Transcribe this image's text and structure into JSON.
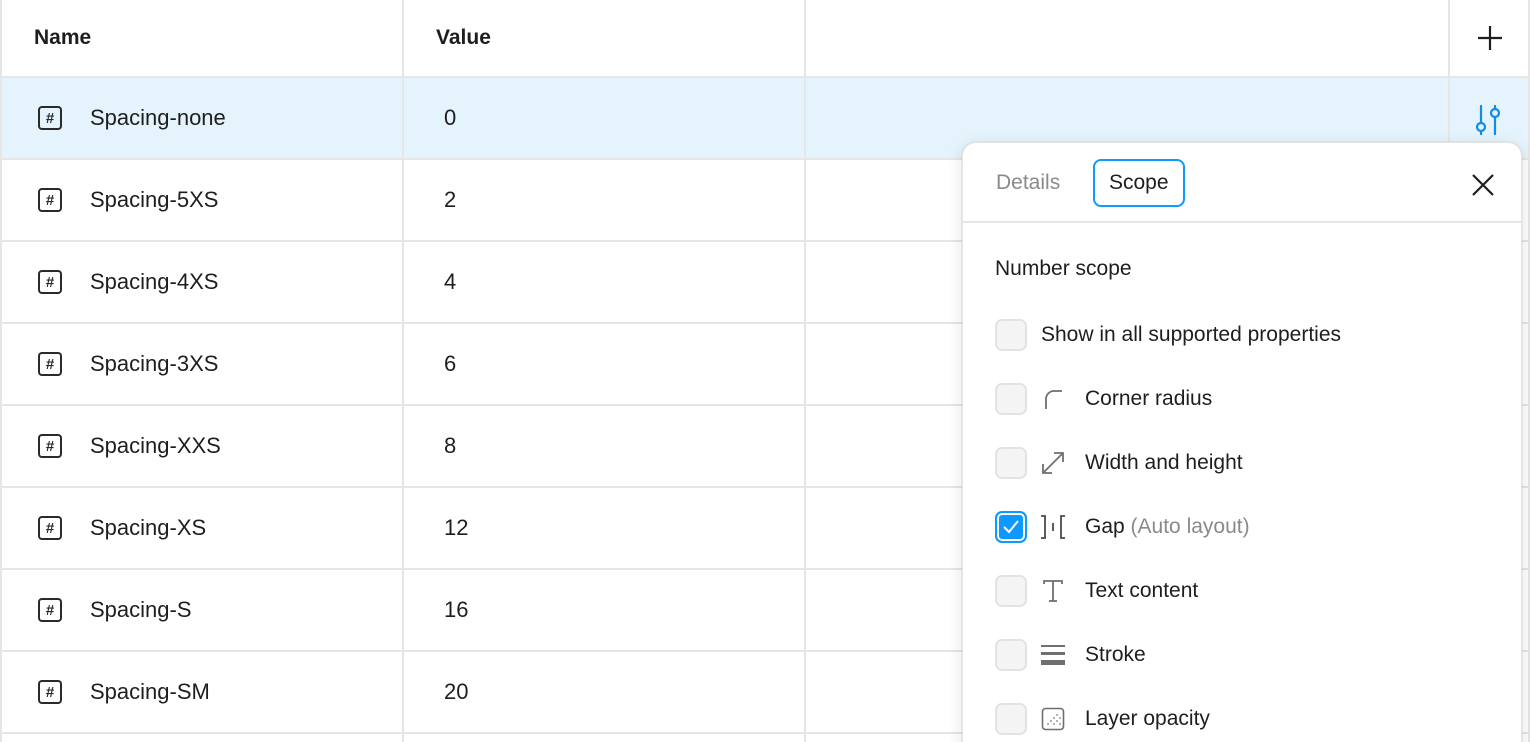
{
  "table": {
    "headers": {
      "name": "Name",
      "value": "Value"
    },
    "rows": [
      {
        "name": "Spacing-none",
        "value": "0"
      },
      {
        "name": "Spacing-5XS",
        "value": "2"
      },
      {
        "name": "Spacing-4XS",
        "value": "4"
      },
      {
        "name": "Spacing-3XS",
        "value": "6"
      },
      {
        "name": "Spacing-XXS",
        "value": "8"
      },
      {
        "name": "Spacing-XS",
        "value": "12"
      },
      {
        "name": "Spacing-S",
        "value": "16"
      },
      {
        "name": "Spacing-SM",
        "value": "20"
      }
    ],
    "selected_row": 0,
    "variable_icon": "hash-icon",
    "row_action_icon": "sliders-icon",
    "add_icon": "plus-icon"
  },
  "panel": {
    "tabs": [
      {
        "label": "Details",
        "active": false
      },
      {
        "label": "Scope",
        "active": true
      }
    ],
    "close_icon": "close-icon",
    "section_title": "Number scope",
    "show_all": {
      "label": "Show in all supported properties",
      "checked": false
    },
    "options": [
      {
        "label": "Corner radius",
        "suffix": "",
        "icon": "corner-radius-icon",
        "checked": false
      },
      {
        "label": "Width and height",
        "suffix": "",
        "icon": "resize-icon",
        "checked": false
      },
      {
        "label": "Gap",
        "suffix": "(Auto layout)",
        "icon": "gap-icon",
        "checked": true
      },
      {
        "label": "Text content",
        "suffix": "",
        "icon": "text-icon",
        "checked": false
      },
      {
        "label": "Stroke",
        "suffix": "",
        "icon": "stroke-icon",
        "checked": false
      },
      {
        "label": "Layer opacity",
        "suffix": "",
        "icon": "opacity-icon",
        "checked": false
      }
    ]
  },
  "colors": {
    "accent": "#0d99ff",
    "selected_row": "#e5f3fc",
    "border": "#e6e6e6"
  }
}
